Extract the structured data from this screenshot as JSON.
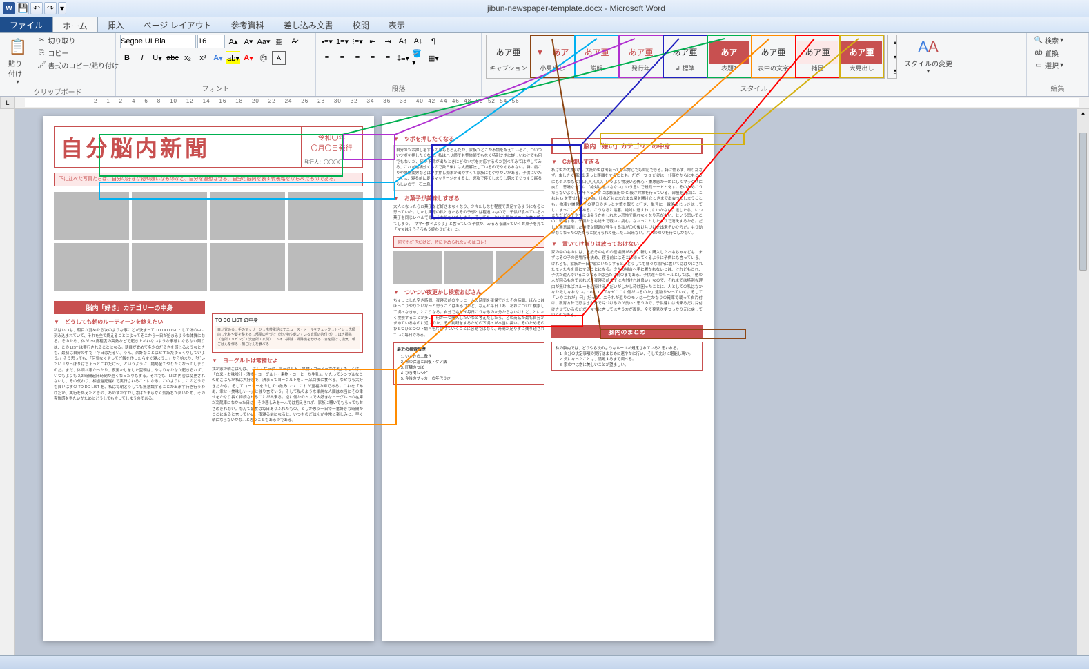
{
  "app": {
    "title": "jibun-newspaper-template.docx - Microsoft Word"
  },
  "tabs": {
    "file": "ファイル",
    "items": [
      "ホーム",
      "挿入",
      "ページ レイアウト",
      "参考資料",
      "差し込み文書",
      "校閲",
      "表示"
    ],
    "active": 0
  },
  "clipboard": {
    "group": "クリップボード",
    "paste": "貼り付け",
    "cut": "切り取り",
    "copy": "コピー",
    "format_painter": "書式のコピー/貼り付け"
  },
  "font": {
    "group": "フォント",
    "name": "Segoe UI Bla",
    "size": "16"
  },
  "paragraph": {
    "group": "段落"
  },
  "styles": {
    "group": "スタイル",
    "change": "スタイルの変更",
    "items": [
      {
        "preview": "あア亜",
        "name": "キャプション",
        "color": "#333",
        "hl": ""
      },
      {
        "preview": "▼　あア",
        "name": "小見出し",
        "color": "#c85050",
        "hl": "#8b4513"
      },
      {
        "preview": "あア亜",
        "name": "説明",
        "color": "#c85050",
        "hl": "#00b0f0"
      },
      {
        "preview": "あア亜",
        "name": "発行年",
        "color": "#c85050",
        "hl": "#b030d0"
      },
      {
        "preview": "あア亜",
        "name": "↲ 標準",
        "color": "#333",
        "hl": "#2020c0"
      },
      {
        "preview": "あア",
        "name": "表題1",
        "color": "#fff",
        "bg": "#c85050",
        "hl": "#00b050"
      },
      {
        "preview": "あア亜",
        "name": "表中の文字",
        "color": "#333",
        "hl": "#ff8c00"
      },
      {
        "preview": "あア亜",
        "name": "補足",
        "color": "#333",
        "bg": "#fce8e8",
        "hl": "#ff0000"
      },
      {
        "preview": "あア亜",
        "name": "大見出し",
        "color": "#fff",
        "bg": "#c85050",
        "hl": "#d4b010"
      }
    ]
  },
  "editing": {
    "group": "編集",
    "find": "検索",
    "replace": "置換",
    "select": "選択"
  },
  "ruler": {
    "corner": "L",
    "marks": "2    1    2    4    6    8    10    12    14    16    18    20    22    24    26    28    30    32    34    36    38    40  42  44  46  48  50  52  54  56"
  },
  "doc": {
    "news_title": "自分脳内新聞",
    "date": "令和〇年\n〇月〇日発行",
    "issuer": "発行人：〇〇〇〇",
    "desc": "下に並べた写真たちは、自分の好きな物や嫌いなものなど、自分を連想させる、自分の脳内を表す代表格をならべたものである。",
    "p1": {
      "cat": "脳内「好き」カテゴリーの中身",
      "s1_h": "どうしても朝のルーティーンを終えたい",
      "s1_t": "私はいつも、朝目が覚めたら次のような事こどが決まって TO DO LIST として体の中に刻み込まれていて、それを全て終えることによってそこから一日が始まるような体質になる。そのため、体が 39 度程度の高熱などで起き上がれないような事態にならない限りは、この LIST は実行されることになる。朝目が覚めて多少のだるさを感じるようなときも、最初は自分の中で「今日はだるい。うん。余計なことはせずただゆっくりしていよう。」そう思っても、「何気なくやってご飯を作ったらすぐ寝よう…」から始まり、「だいたい「やっぽりはちょっとこれだけ～」というように、結局全てやりたくなってしまうのだ。まだ、体調が悪かったり、夜更かしをした翌朝は、やはりなかなか起きられず、いつもよりも 2,3 時間起床時刻が遅くなったりもする。それでも、LIST 内容は変更されないし、その代わり、相当遅延遅れで実行されることになる。このように、このどうでも良いはずの TO DO LIST を、私は毎朝どうしても無意識することが出来ず行き行うわけだが、実行を終えたときの、あのすがすがしさはたまらなく気持ちが良いため、その爽快感を得たいがためにどうしてもやってしまうのである。",
      "todo_title": "TO DO LIST の中身",
      "todo_text": "目が覚める→手のマッサージ→携帯電話にてニュース・メールをチェック→トイレ→洗顔歯→化粧や髪を整える→部屋の片づけ（洗い物や乾いている衣類の片付け）→はき掃除（台所・リビング・洗面所・玄関）→トイレ掃除→掃除機をかける→窓を開けて換気→朝ごはんを作る→朝ごはんを食べる",
      "s2_h": "ヨーグルトは常備せよ",
      "s2_t": "我が家の朝ごはんは、「パン・サラダ・ヨーグルト・果物・コーヒーか牛乳」もしくは、「白米・お味噌汁・漬物・ヨーグルト・果物・コーヒーか牛乳」。いたってシンプルなこの朝ごはんが私は大好きで、決まってヨーグルトを…一品目後に食べる。なぜなら大好きだから。そしてコーヒーを少しずつ飲みつつ…これが至福の時である。これを「ああ、幸せ～美味しい～」と独り言でいう。そして私のような単純な人間は本当にその幸せをかなり長く持続させることが出来る。逆に何かのミスで大好きなヨーグルトの在庫が冷蔵庫になかった日は、その悲しみを一人では抱えきれず、家族に騒いでもらってもおさめきれない。なんて朝食は毎日ありふれたもの、としか思う一日で一番好きな時間がここにあると言っていい、夜寝る前になると、いつものごはんが非常に楽しみと、早く朝にならないかな…と思うこともあるのである。"
    },
    "p2": {
      "s1_h": "ツボを押したくなる",
      "s1_t": "自分のツボ押しをするのはもちろんだが、家族がどこか不調を訴えていると、ついついツボを押したくなる。私はハリ師でも整体師でもなく特別ツボに詳しいわけでも何でもないが、何か不調が出たときにどのツボを対応するのか割べてみては押してみる、これが結構効くもので数日後には大抵解決しているのでやめられない。特に肩こりや眼精疲労などはツボ押し効果が出やすくて家族にもやりがいがある。子供にいたっては、寝る前に足裏マッサージをすると、速攻で寝てしまうし朝までぐっすり眠るらしいので一石二鳥。",
      "s2_h": "お菓子が美味しすぎる",
      "s2_t": "大人になったらお菓子など好きまなくなり、少々たしなむ程度で満足するようになると思っていた。しかし実際の私ときたらその予想とは程遠いもので、子供が食べているお菓子を同じレベルで欲しくなりむいたしまう。そしてあっという間にペロリと食べ終えてしまう。「ママ～食べようよ」と言っていた子供が、みるみる減っていくお菓子を見て「ママはそろそろもう終わりだよ」と。",
      "highlight": "何でも好きだけど、特にやめられないのはコレ！",
      "s3_h": "ついつい夜更かし検索おばさん",
      "s3_t": "ちょっとした空き時間、夜寝る前のやっと一人の時間を確保できたその時間、ほんとはほっこりやりたいな～と思うことはあるけれど、なんせ毎日「あ、あれについて検索して調べなきゃ」とこうなる。自分でもなぜ毎日こうなるのか分からないけれど、とにかく検索することが多い。何か一つ購入したいなと考えだしたら、どの商品が最も自分が求めているものに近いのか、その判断をするための下調べが本当に長い。そのためそのひとつひとつの下調べを片付けていくことに容易ではなく、時間が足りずに残り越されていく毎日である。",
      "search_title": "最近の検索履歴",
      "search_items": [
        "いぐさの上敷き",
        "布の保湿と回復・ケア法",
        "肝臓のつぼ",
        "ひき肉レシピ",
        "今後のサッカーの年代りさ"
      ],
      "cat2": "脳内「嫌い」カテゴリーの中身",
      "s4_h": "Gが嫌いすぎる",
      "s4_t": "私は虫が大嫌いだ。大抵の虫は出会っても平常心でも対応できる。特に慌らず、取り乱さず。虫しきく解決出来っと距離をすることも。だが一つ G だけは一仕事かからにもこうにもダメなものだ口〇〇〇〇。いうより物凄い恐怖心・嫌悪感が一瞬にしてマックスに戻り、悲鳴なまでに「絶対に逃がさない」いう思いで殺戮モードと化す。そのためこうならないよう、毎年ベランダには悲痛用の G 殺け対策を行っている。部屋を清潔に、これも G を寄せ付けない為。けれどもたまたま玄関を開けたときまで出会ってしまうことも。物凄い嫌悪、その翌日のきっと対策を取りに行き、単号に一戦略まじっきはしてし。まっこことがある。こうなると最悪。絶対に逃すわけにいかない。逃したら、いつまただどこでやつに出会うかもしれない恐怖で眠れなくなり苦がない、という思いでこのこ戦場する。子供たちも総出で戦いに挑む。なかっことしたようで消失するから。だしし無意識削した後夜な問題が発生する私が〇の後け片づけを出来そいからだ。もう動かなくなったのだからと捉えられて仕…だ…出来ない。パパの帰りを待つしかない。",
      "s5_h": "置いてけぼりは放っておけない",
      "s5_t": "家の中のものには、大抵そのものの居場所がある。新しく購入したおもちゃなども、まずはその子の居場所を決め、寝る前にはそこに帰ってくるように子供にも言っている。けれども、家族が一日中家にいたりすると、どうしても様々な場所に置いてはばりにされたモノたちを目にすることになる。少々の場合へ手に置かれないとは、けれどもこれ、子供が遊んでいるこうなるのは当たり前の事である。子供達へのルールとしては、「他の人が困るものであれば、夜寝る前までに片付ければ良い」なので、それまでは特別な理由が無ければスルーを心掛ける。だいがしかし砕け困ったことに、人としての私はなかなか欲しなれない。ついつい「なぜここに何がいるのか」遺跡りやっていく。そして「いやこれが」何」だった。ニそれが返りのモノは一生かなりの確率で載って右片付け、教育方針で忍ぶき自分で片づけるのが良いと思うので、子供達には出来るだけ片付けさせているのだが、ママに言っては言う方が面倒、全て発見次第つっかり元に戻していくのである。",
      "summary_cat": "脳内のまとめ",
      "summary_intro": "私の脳内では、どうやら次のようなルールが規定されていると思われる。",
      "summary_items": [
        "自分の決定事項の実行はまじめに速やかに行い、そして充分に堪能し現い。",
        "気になったことは、満足するまで調べる。",
        "家の中は常に美しいことが望ましい。"
      ]
    }
  }
}
